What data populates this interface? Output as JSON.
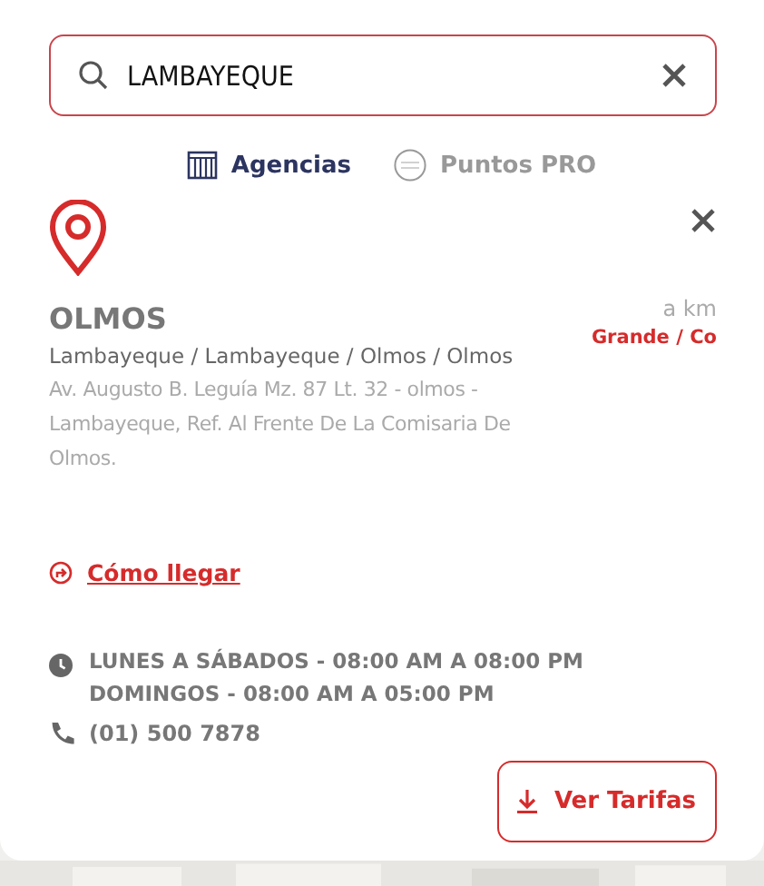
{
  "search": {
    "value": "LAMBAYEQUE"
  },
  "tabs": [
    {
      "label": "Agencias",
      "kind": "agency",
      "selected": true
    },
    {
      "label": "Puntos PRO",
      "kind": "pro",
      "selected": false
    }
  ],
  "agency": {
    "name": "OLMOS",
    "distance": "a km",
    "type": "Grande / Co",
    "region": "Lambayeque / Lambayeque / Olmos / Olmos",
    "address": "Av. Augusto B. Leguía Mz. 87 Lt. 32  - olmos - Lambayeque, Ref. Al Frente De La Comisaria De Olmos.",
    "directions_link": "Cómo llegar",
    "hours": [
      "LUNES A SÁBADOS - 08:00 AM A 08:00 PM",
      "DOMINGOS - 08:00 AM A 05:00 PM"
    ],
    "phone": "(01) 500 7878",
    "button": "Ver Tarifas"
  }
}
